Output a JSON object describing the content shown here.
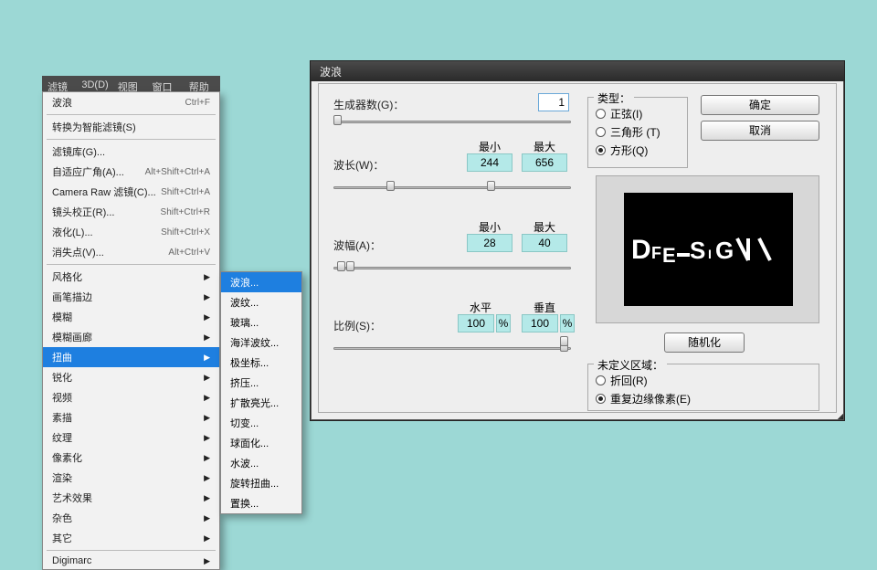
{
  "menubar": {
    "items": [
      "滤镜(T)",
      "3D(D)",
      "视图(V)",
      "窗口(W)",
      "帮助(H)"
    ]
  },
  "menu": {
    "items": [
      {
        "label": "波浪",
        "shortcut": "Ctrl+F"
      },
      {
        "sep": true
      },
      {
        "label": "转换为智能滤镜(S)"
      },
      {
        "sep": true
      },
      {
        "label": "滤镜库(G)..."
      },
      {
        "label": "自适应广角(A)...",
        "shortcut": "Alt+Shift+Ctrl+A"
      },
      {
        "label": "Camera Raw 滤镜(C)...",
        "shortcut": "Shift+Ctrl+A"
      },
      {
        "label": "镜头校正(R)...",
        "shortcut": "Shift+Ctrl+R"
      },
      {
        "label": "液化(L)...",
        "shortcut": "Shift+Ctrl+X"
      },
      {
        "label": "消失点(V)...",
        "shortcut": "Alt+Ctrl+V"
      },
      {
        "sep": true
      },
      {
        "label": "风格化",
        "arrow": true
      },
      {
        "label": "画笔描边",
        "arrow": true
      },
      {
        "label": "模糊",
        "arrow": true
      },
      {
        "label": "模糊画廊",
        "arrow": true
      },
      {
        "label": "扭曲",
        "arrow": true,
        "sel": true
      },
      {
        "label": "锐化",
        "arrow": true
      },
      {
        "label": "视频",
        "arrow": true
      },
      {
        "label": "素描",
        "arrow": true
      },
      {
        "label": "纹理",
        "arrow": true
      },
      {
        "label": "像素化",
        "arrow": true
      },
      {
        "label": "渲染",
        "arrow": true
      },
      {
        "label": "艺术效果",
        "arrow": true
      },
      {
        "label": "杂色",
        "arrow": true
      },
      {
        "label": "其它",
        "arrow": true
      },
      {
        "sep": true
      },
      {
        "label": "Digimarc",
        "arrow": true
      }
    ]
  },
  "submenu": {
    "items": [
      "波浪...",
      "波纹...",
      "玻璃...",
      "海洋波纹...",
      "极坐标...",
      "挤压...",
      "扩散亮光...",
      "切变...",
      "球面化...",
      "水波...",
      "旋转扭曲...",
      "置换..."
    ],
    "selIndex": 0
  },
  "dialog": {
    "title": "波浪",
    "generator": {
      "label": "生成器数(G)：",
      "value": "1"
    },
    "wavelength": {
      "label": "波长(W)：",
      "minLabel": "最小",
      "maxLabel": "最大",
      "min": "244",
      "max": "656"
    },
    "amplitude": {
      "label": "波幅(A)：",
      "minLabel": "最小",
      "maxLabel": "最大",
      "min": "28",
      "max": "40"
    },
    "scale": {
      "label": "比例(S)：",
      "hLabel": "水平",
      "vLabel": "垂直",
      "h": "100",
      "v": "100",
      "pct": "%"
    },
    "type": {
      "legend": "类型：",
      "options": [
        "正弦(I)",
        "三角形 (T)",
        "方形(Q)"
      ],
      "checkedIndex": 2
    },
    "undef": {
      "legend": "未定义区域：",
      "options": [
        "折回(R)",
        "重复边缘像素(E)"
      ],
      "checkedIndex": 1
    },
    "buttons": {
      "ok": "确定",
      "cancel": "取消",
      "random": "随机化"
    },
    "previewText": "DESIGN"
  }
}
